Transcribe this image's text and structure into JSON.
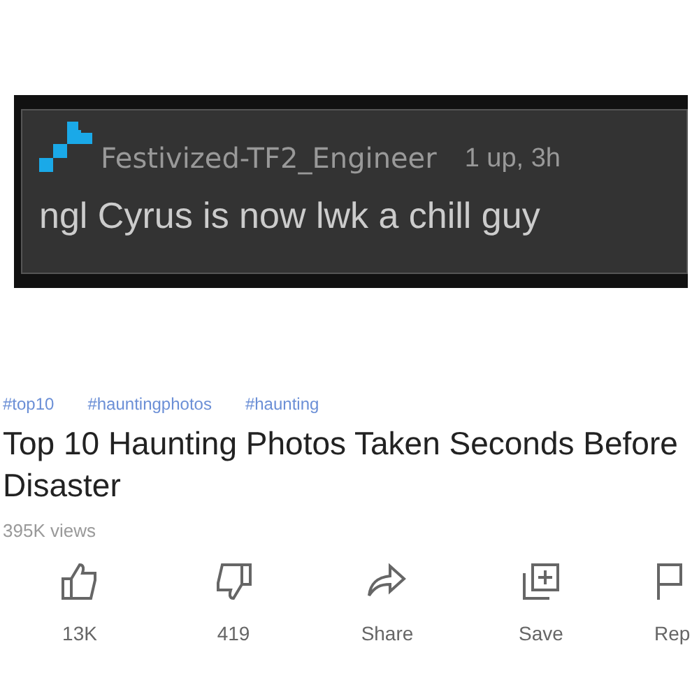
{
  "comment": {
    "username": "Festivized-TF2_Engineer",
    "meta": "1 up, 3h",
    "text": "ngl Cyrus is now lwk a chill guy"
  },
  "video": {
    "hashtags": [
      "#top10",
      "#hauntingphotos",
      "#haunting"
    ],
    "title": "Top 10 Haunting Photos Taken Seconds Before Disaster",
    "views": "395K views",
    "actions": [
      {
        "kind": "like",
        "label": "13K"
      },
      {
        "kind": "dislike",
        "label": "419"
      },
      {
        "kind": "share",
        "label": "Share"
      },
      {
        "kind": "save",
        "label": "Save"
      },
      {
        "kind": "report",
        "label": "Rep"
      }
    ]
  }
}
